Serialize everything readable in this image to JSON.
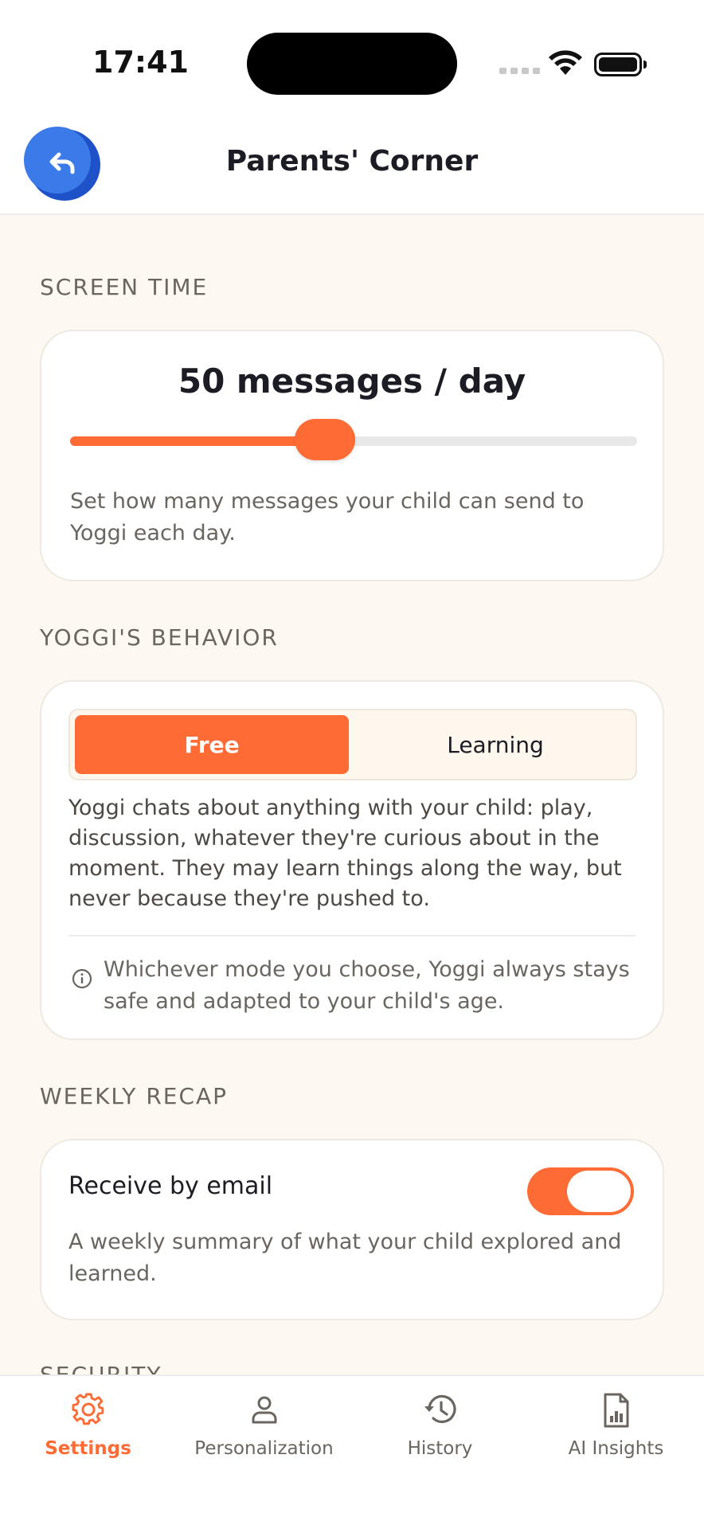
{
  "status_bar": {
    "time": "17:41"
  },
  "header": {
    "title": "Parents' Corner",
    "back_icon": "undo-arrow-icon"
  },
  "screen_time": {
    "section_label": "SCREEN TIME",
    "value_label": "50 messages / day",
    "slider_fraction": 0.45,
    "description": "Set how many messages your child can send to Yoggi each day."
  },
  "behavior": {
    "section_label": "YOGGI'S BEHAVIOR",
    "modes": [
      "Free",
      "Learning"
    ],
    "selected_mode": "Free",
    "description": "Yoggi chats about anything with your child: play, discussion, whatever they're curious about in the moment. They may learn things along the way, but never because they're pushed to.",
    "info_text": "Whichever mode you choose, Yoggi always stays safe and adapted to your child's age."
  },
  "weekly_recap": {
    "section_label": "WEEKLY RECAP",
    "toggle_label": "Receive by email",
    "toggle_on": true,
    "description": "A weekly summary of what your child explored and learned."
  },
  "security": {
    "section_label": "SECURITY"
  },
  "tab_bar": {
    "items": [
      {
        "label": "Settings",
        "icon": "gear-icon",
        "active": true
      },
      {
        "label": "Personalization",
        "icon": "person-icon",
        "active": false
      },
      {
        "label": "History",
        "icon": "history-icon",
        "active": false
      },
      {
        "label": "AI Insights",
        "icon": "report-icon",
        "active": false
      }
    ]
  },
  "colors": {
    "accent": "#ff6b35",
    "back_button": "#3b7be9",
    "background": "#fdf8f1"
  }
}
